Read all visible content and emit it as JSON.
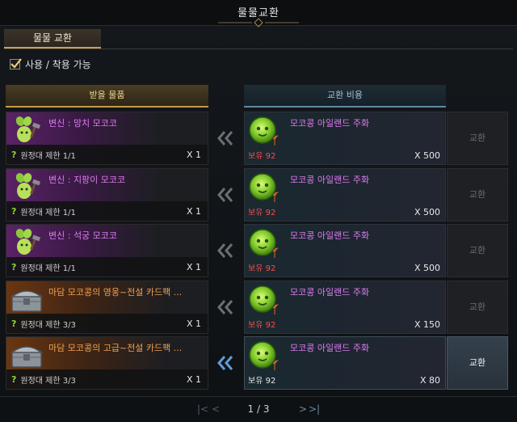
{
  "window": {
    "title": "물물교환"
  },
  "tab": {
    "label": "물물 교환"
  },
  "filter": {
    "label": "사용 / 착용 가능",
    "checked": true
  },
  "headers": {
    "receive": "받을 물품",
    "cost": "교환 비용"
  },
  "rows": [
    {
      "reward_name": "변신 : 망치 모코코",
      "reward_color": "purple",
      "limit": "원정대 제한 1/1",
      "reward_qty": "X 1",
      "cost_name": "모코콩 아일랜드 주화",
      "owned": "보유 92",
      "owned_ok": false,
      "cost_qty": "X 500",
      "button": "교환",
      "enabled": false
    },
    {
      "reward_name": "변신 : 지팡이 모코코",
      "reward_color": "purple",
      "limit": "원정대 제한 1/1",
      "reward_qty": "X 1",
      "cost_name": "모코콩 아일랜드 주화",
      "owned": "보유 92",
      "owned_ok": false,
      "cost_qty": "X 500",
      "button": "교환",
      "enabled": false
    },
    {
      "reward_name": "변신 : 석궁 모코코",
      "reward_color": "purple",
      "limit": "원정대 제한 1/1",
      "reward_qty": "X 1",
      "cost_name": "모코콩 아일랜드 주화",
      "owned": "보유 92",
      "owned_ok": false,
      "cost_qty": "X 500",
      "button": "교환",
      "enabled": false
    },
    {
      "reward_name": "마담 모코콩의 영웅~전설 카드팩 ...",
      "reward_color": "orange",
      "limit": "원정대 제한 3/3",
      "reward_qty": "X 1",
      "cost_name": "모코콩 아일랜드 주화",
      "owned": "보유 92",
      "owned_ok": false,
      "cost_qty": "X 150",
      "button": "교환",
      "enabled": false
    },
    {
      "reward_name": "마담 모코콩의 고급~전설 카드팩 ...",
      "reward_color": "orange",
      "limit": "원정대 제한 3/3",
      "reward_qty": "X 1",
      "cost_name": "모코콩 아일랜드 주화",
      "owned": "보유 92",
      "owned_ok": true,
      "cost_qty": "X 80",
      "button": "교환",
      "enabled": true
    }
  ],
  "pager": {
    "current": "1 / 3"
  },
  "colors": {
    "accent_gold": "#c89b45",
    "accent_blue": "#5f8aa0",
    "insufficient": "#ff4a4a",
    "item_purple": "#dd7bf0",
    "item_orange": "#f0a050"
  },
  "icons": {
    "reward_purple": "mokoko-seed-icon",
    "reward_orange": "card-pack-chest-icon",
    "cost": "mokoko-coin-icon",
    "arrow": "double-chevron-left-icon"
  }
}
